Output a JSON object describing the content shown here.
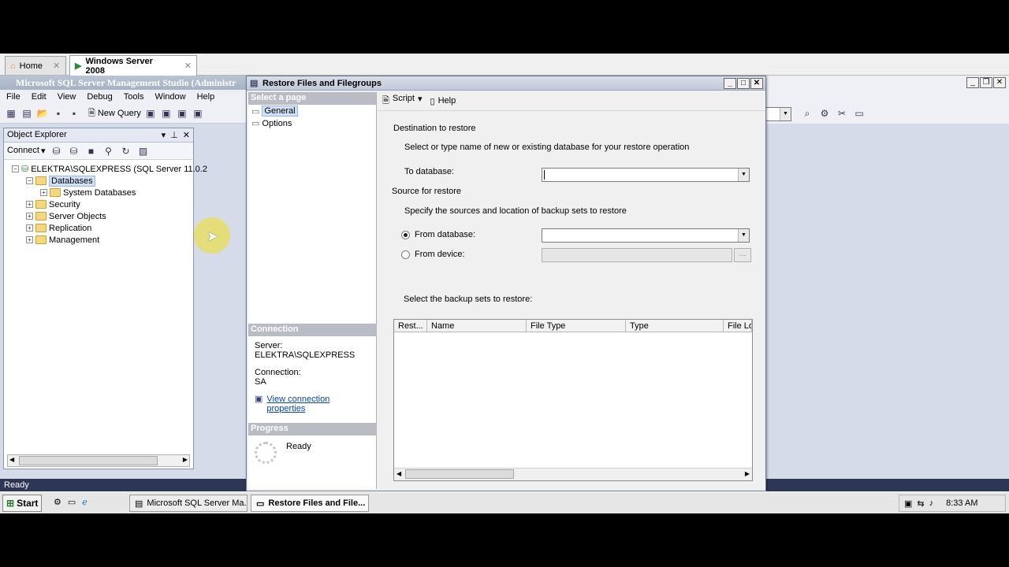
{
  "vm_tabs": [
    {
      "label": "Home",
      "active": false
    },
    {
      "label": "Windows Server 2008",
      "active": true
    }
  ],
  "ssms": {
    "title": "Microsoft SQL Server Management Studio (Administr",
    "menu": [
      "File",
      "Edit",
      "View",
      "Debug",
      "Tools",
      "Window",
      "Help"
    ],
    "new_query": "New Query",
    "status": "Ready"
  },
  "object_explorer": {
    "title": "Object Explorer",
    "connect": "Connect",
    "server_node": "ELEKTRA\\SQLEXPRESS (SQL Server 11.0.2",
    "nodes": [
      "Databases",
      "System Databases",
      "Security",
      "Server Objects",
      "Replication",
      "Management"
    ]
  },
  "dialog": {
    "title": "Restore Files and Filegroups",
    "select_page_header": "Select a page",
    "pages": [
      "General",
      "Options"
    ],
    "toolbar": {
      "script": "Script",
      "help": "Help"
    },
    "destination_header": "Destination to restore",
    "destination_desc": "Select or type name of new or existing database for your restore operation",
    "to_database_label": "To database:",
    "source_header": "Source for restore",
    "source_desc": "Specify the sources and location of backup sets to restore",
    "from_database_label": "From database:",
    "from_device_label": "From device:",
    "browse_label": "...",
    "backup_sets_label": "Select the backup sets to restore:",
    "grid_columns": [
      "Rest...",
      "Name",
      "File Type",
      "Type",
      "File Lo"
    ],
    "connection_header": "Connection",
    "server_label": "Server:",
    "server_value": "ELEKTRA\\SQLEXPRESS",
    "connection_label": "Connection:",
    "connection_value": "SA",
    "view_connection": "View connection properties",
    "progress_header": "Progress",
    "progress_status": "Ready"
  },
  "taskbar": {
    "start": "Start",
    "buttons": [
      "Microsoft SQL Server Ma...",
      "Restore Files and File..."
    ],
    "clock": "8:33 AM"
  }
}
